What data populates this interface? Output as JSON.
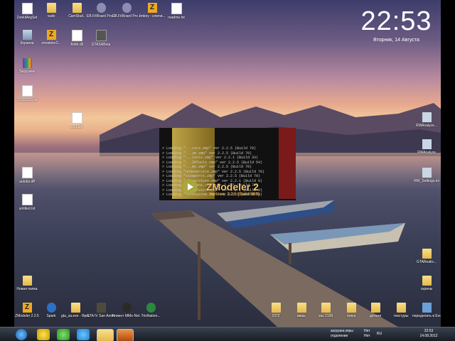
{
  "clock": {
    "time": "22:53",
    "date": "Вторник, 14 Августа"
  },
  "desktop_icons_left": [
    {
      "label": "ZonkitArgSet",
      "kind": "file"
    },
    {
      "label": "vado",
      "kind": "folder"
    },
    {
      "label": "CamStud..",
      "kind": "folder"
    },
    {
      "label": "EB.FitBoard Pro 1.6.6.exe",
      "kind": "exe"
    },
    {
      "label": "EB.FitBoard Pro 1.8 Restore",
      "kind": "exe"
    },
    {
      "label": "zmkey - ключи...",
      "kind": "zm"
    },
    {
      "label": "readme.txt",
      "kind": "file"
    },
    {
      "label": "Корзина",
      "kind": "bin"
    },
    {
      "label": "zmodeler2...",
      "kind": "zm"
    },
    {
      "label": "Artkit.dll",
      "kind": "file"
    },
    {
      "label": "GTASABeta",
      "kind": "dark"
    },
    {
      "label": "Загрузчик",
      "kind": "rar"
    },
    {
      "label": "33333333.txt",
      "kind": "file"
    },
    {
      "label": "333.zm",
      "kind": "file"
    },
    {
      "label": "autobs.dff",
      "kind": "file"
    },
    {
      "label": "untitled.txt",
      "kind": "file"
    },
    {
      "label": "Новая папка",
      "kind": "folder"
    }
  ],
  "desktop_icons_bottom": [
    {
      "label": "ZModeler 2.2.5",
      "kind": "zm"
    },
    {
      "label": "Spark",
      "kind": "spark"
    },
    {
      "label": "gta_sa.exe - Ярлык",
      "kind": "folder"
    },
    {
      "label": "GTA IV San Andreas",
      "kind": "gta"
    },
    {
      "label": "Клиент MMo-Net...",
      "kind": "alien"
    },
    {
      "label": "TrioNation...",
      "kind": "green"
    },
    {
      "label": "2372",
      "kind": "folder"
    },
    {
      "label": "вишь",
      "kind": "folder"
    },
    {
      "label": "vaz 2109",
      "kind": "folder"
    },
    {
      "label": "тачка",
      "kind": "folder"
    },
    {
      "label": "детали",
      "kind": "folder"
    },
    {
      "label": "текстуры",
      "kind": "folder"
    },
    {
      "label": "переделать в Excel",
      "kind": "pic"
    }
  ],
  "desktop_icons_right": [
    {
      "label": "RWAnalyze...",
      "kind": "rw"
    },
    {
      "label": "RWAnalyze",
      "kind": "rw"
    },
    {
      "label": "RW_Settings.ini",
      "kind": "rw"
    },
    {
      "label": "GTARealis...",
      "kind": "folder"
    },
    {
      "label": "скрины",
      "kind": "folder"
    }
  ],
  "zmodeler_window": {
    "title": "ZModeler 2",
    "version": "Version: 2.2.5 (Build 989)",
    "log": [
      "> Loading \"...core.zmp\" ver 2.2.5 (Build 70)",
      "> Loading \"...zm.zmp\" ver 2.2.5 (Build 70)",
      "> Loading \"...tools.zmp\" ver 2.2.1 (Build 33)",
      "> Loading \"...ZMTools.zmp\" ver 2.2.5 (Build 54)",
      "> Loading \"...mp.zmp\" ver 2.2.5 (Build 70)",
      "> Loading \"undoservice.zmp\" ver 2.2.5 (Build 70)",
      "> Loading \"viewports.zmp\" ver 2.2.5 (Build 70)",
      "> Loading \"...services.zmp\" ver 2.2.1 (Build 9)",
      "> Loading \"...lcons.zmp\" ver 2.2.5 (Build 70)",
      "> Loading \"...services.zmp\" ver 2.2.1 (Build 9)",
      "> Loading \"filesystem.zmp\" ver 2.2.5 (Build 70)"
    ]
  },
  "taskbar": {
    "tray_text_1": "загрузка игры",
    "tray_text_2": "отделение",
    "tray_net": "Нет",
    "lang": "RU",
    "time": "22:53",
    "date": "14.08.2012"
  }
}
